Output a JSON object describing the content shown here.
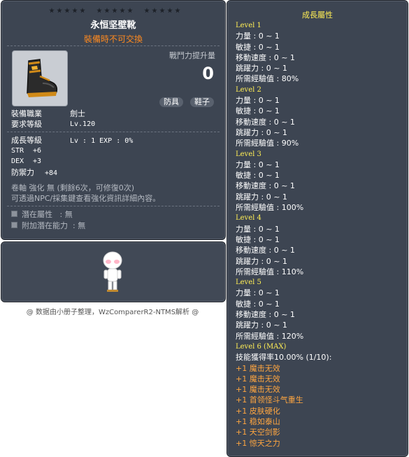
{
  "item_id": "01072355",
  "item": {
    "name": "永恒坚壁靴",
    "trade_note": "裝備時不可交換",
    "power_label": "戰鬥力提升量",
    "power_value": "0",
    "tags": [
      "防具",
      "鞋子"
    ],
    "job_label": "裝備職業",
    "job_value": "劍士",
    "req_level_label": "要求等級",
    "req_level_value": "Lv.120",
    "growth_label": "成長等級",
    "growth_value": "Lv : 1  EXP : 0%",
    "stats": [
      {
        "name": "STR",
        "value": "+6"
      },
      {
        "name": "DEX",
        "value": "+3"
      },
      {
        "name": "防禦力",
        "value": "+84"
      }
    ],
    "upgrade_line": "卷軸 強化 無 (剩餘6次，可修復0次)",
    "npc_line": "可透過NPC/採集鍵查看強化資訊詳細內容。",
    "potential_label": "潛在屬性",
    "potential_value": ": 無",
    "add_potential_label": "附加潛在能力",
    "add_potential_value": ": 無",
    "icon": "boots-icon"
  },
  "preview": {
    "icon": "character-avatar"
  },
  "growth": {
    "title": "成長屬性",
    "levels": [
      {
        "label": "Level 1",
        "lines": [
          "力量 : 0 ~ 1",
          "敏捷 : 0 ~ 1",
          "移動速度 : 0 ~ 1",
          "跳躍力 : 0 ~ 1",
          "所需經驗值 : 80%"
        ]
      },
      {
        "label": "Level 2",
        "lines": [
          "力量 : 0 ~ 1",
          "敏捷 : 0 ~ 1",
          "移動速度 : 0 ~ 1",
          "跳躍力 : 0 ~ 1",
          "所需經驗值 : 90%"
        ]
      },
      {
        "label": "Level 3",
        "lines": [
          "力量 : 0 ~ 1",
          "敏捷 : 0 ~ 1",
          "移動速度 : 0 ~ 1",
          "跳躍力 : 0 ~ 1",
          "所需經驗值 : 100%"
        ]
      },
      {
        "label": "Level 4",
        "lines": [
          "力量 : 0 ~ 1",
          "敏捷 : 0 ~ 1",
          "移動速度 : 0 ~ 1",
          "跳躍力 : 0 ~ 1",
          "所需經驗值 : 110%"
        ]
      },
      {
        "label": "Level 5",
        "lines": [
          "力量 : 0 ~ 1",
          "敏捷 : 0 ~ 1",
          "移動速度 : 0 ~ 1",
          "跳躍力 : 0 ~ 1",
          "所需經驗值 : 120%"
        ]
      }
    ],
    "max_level": {
      "label": "Level 6 (MAX)",
      "skill_rate": "技能獲得率10.00% (1/10):",
      "skills": [
        "+1 魔击无效",
        "+1 魔击无效",
        "+1 魔击无效",
        "+1 首领怪斗气重生",
        "+1 皮肤硬化",
        "+1 稳如泰山",
        "+1 天空剑影",
        "+1 惊天之力"
      ]
    }
  },
  "footer": "@ 数据由小册子整理，WzComparerR2-NTMS解析 @",
  "colors": {
    "panel_bg": "#3d4552",
    "level_yellow": "#ffee55",
    "skill_orange": "#ffa640",
    "trade_orange": "#ff8a1f"
  }
}
